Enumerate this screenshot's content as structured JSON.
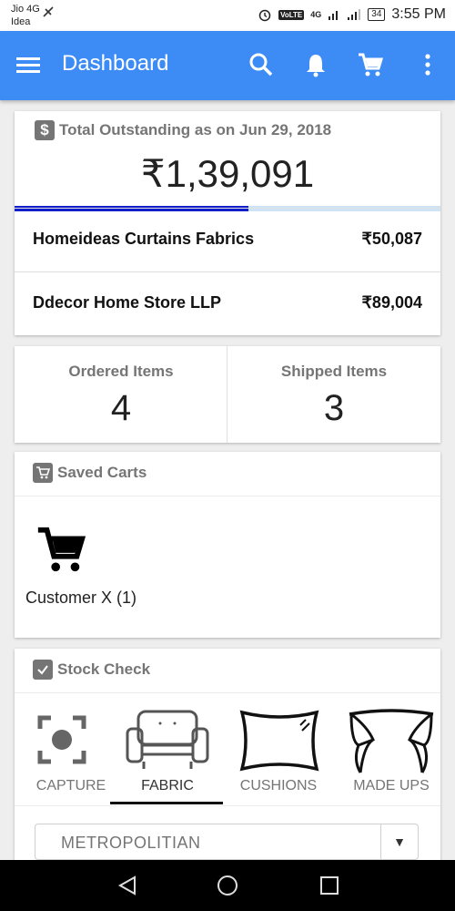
{
  "status_bar": {
    "carrier_line1": "Jio 4G",
    "carrier_line2": "Idea",
    "volte": "VoLTE",
    "network": "4G",
    "battery": "34",
    "time": "3:55 PM"
  },
  "app_bar": {
    "title": "Dashboard",
    "icons": [
      "menu-icon",
      "search-icon",
      "bell-icon",
      "cart-icon",
      "more-vert-icon"
    ],
    "color": "#3d8cf5"
  },
  "outstanding": {
    "heading": "Total Outstanding as on Jun 29, 2018",
    "amount": "₹1,39,091",
    "progress_fraction": 0.55,
    "rows": [
      {
        "name": "Homeideas Curtains Fabrics",
        "amount": "₹50,087"
      },
      {
        "name": "Ddecor Home Store LLP",
        "amount": "₹89,004"
      }
    ]
  },
  "stats": {
    "ordered_label": "Ordered Items",
    "ordered_value": "4",
    "shipped_label": "Shipped Items",
    "shipped_value": "3"
  },
  "saved_carts": {
    "heading": "Saved Carts",
    "item_label": "Customer X (1)"
  },
  "stock_check": {
    "heading": "Stock Check",
    "tabs": [
      {
        "label": "CAPTURE",
        "icon": "capture-icon"
      },
      {
        "label": "FABRIC",
        "icon": "armchair-icon",
        "active": true
      },
      {
        "label": "CUSHIONS",
        "icon": "cushion-icon"
      },
      {
        "label": "MADE UPS",
        "icon": "curtain-icon"
      }
    ],
    "select_value": "METROPOLITIAN"
  }
}
